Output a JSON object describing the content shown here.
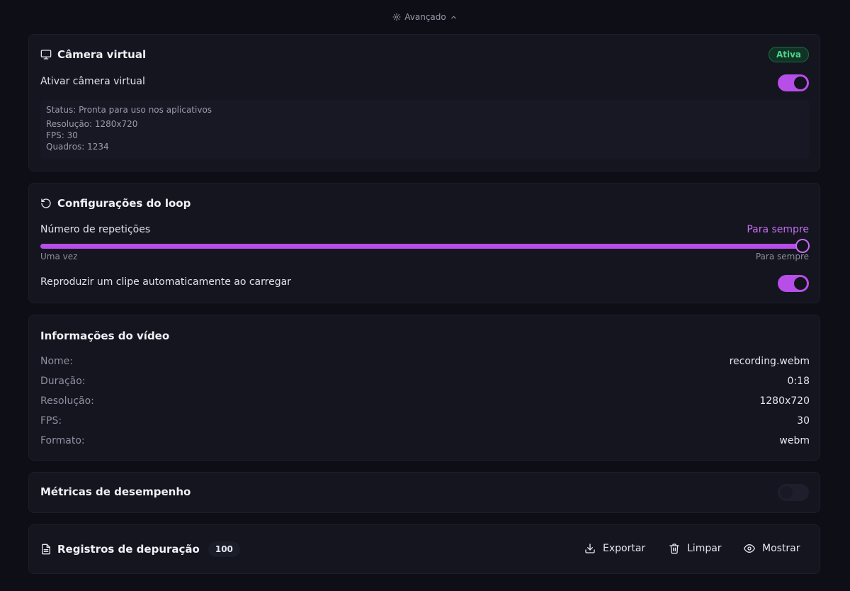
{
  "advanced": {
    "label": "Avançado",
    "icons": {
      "settings": "gear-icon",
      "toggle": "chevron-up-icon"
    }
  },
  "virtual_camera": {
    "title": "Câmera virtual",
    "icon": "monitor-icon",
    "status_badge": "Ativa",
    "enable_label": "Ativar câmera virtual",
    "enabled": true,
    "status": {
      "status_line": "Status: Pronta para uso nos aplicativos",
      "resolution_line": "Resolução: 1280x720",
      "fps_line": "FPS: 30",
      "frames_line": "Quadros: 1234"
    }
  },
  "loop": {
    "title": "Configurações do loop",
    "icon": "rotate-ccw-icon",
    "repetitions_label": "Número de repetições",
    "repetitions_value": "Para sempre",
    "slider_min_label": "Uma vez",
    "slider_max_label": "Para sempre",
    "slider_fraction": 1.0,
    "autoplay_label": "Reproduzir um clipe automaticamente ao carregar",
    "autoplay_enabled": true
  },
  "video_info": {
    "title": "Informações do vídeo",
    "rows": [
      {
        "key": "Nome:",
        "value": "recording.webm"
      },
      {
        "key": "Duração:",
        "value": "0:18"
      },
      {
        "key": "Resolução:",
        "value": "1280x720"
      },
      {
        "key": "FPS:",
        "value": "30"
      },
      {
        "key": "Formato:",
        "value": "webm"
      }
    ]
  },
  "performance": {
    "title": "Métricas de desempenho",
    "enabled": false
  },
  "debug_logs": {
    "title": "Registros de depuração",
    "icon": "file-text-icon",
    "count": "100",
    "export_label": "Exportar",
    "clear_label": "Limpar",
    "show_label": "Mostrar",
    "action_icons": {
      "export": "download-icon",
      "clear": "trash-icon",
      "show": "eye-icon"
    }
  },
  "colors": {
    "accent": "#b84ee8",
    "success": "#4fd38a",
    "background": "#0d0e16",
    "card": "#14151f"
  }
}
